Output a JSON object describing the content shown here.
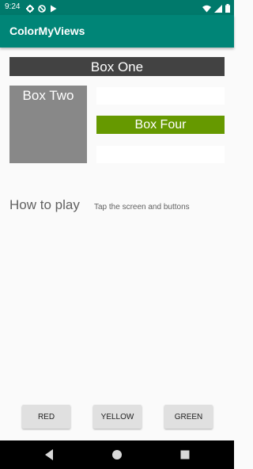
{
  "status_bar": {
    "time": "9:24",
    "icons_left": [
      "gear-icon",
      "no-disturb-icon",
      "play-store-icon"
    ],
    "icons_right": [
      "wifi-icon",
      "signal-icon",
      "battery-icon"
    ],
    "background": "#00796b"
  },
  "app_bar": {
    "title": "ColorMyViews",
    "background": "#008577"
  },
  "boxes": {
    "box_one": {
      "label": "Box One",
      "color": "#424242"
    },
    "box_two": {
      "label": "Box Two",
      "color": "#888888"
    },
    "box_three": {
      "label": "",
      "color": "#ffffff"
    },
    "box_four": {
      "label": "Box Four",
      "color": "#669900"
    },
    "box_five": {
      "label": "",
      "color": "#ffffff"
    }
  },
  "how_to_play": {
    "label": "How to play",
    "info": "Tap the screen and buttons"
  },
  "buttons": {
    "red": "RED",
    "yellow": "YELLOW",
    "green": "GREEN"
  },
  "nav_bar": {
    "icons": [
      "back-icon",
      "home-icon",
      "recents-icon"
    ]
  }
}
